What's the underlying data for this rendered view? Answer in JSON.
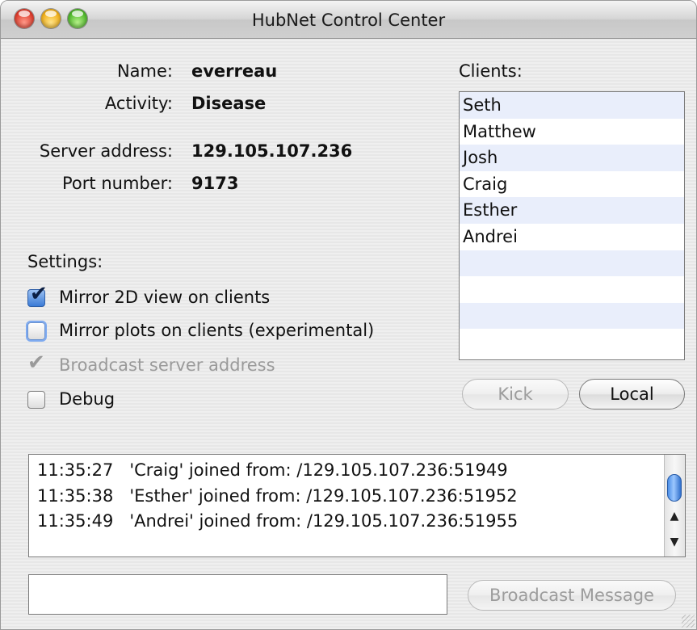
{
  "window": {
    "title": "HubNet Control Center"
  },
  "info": {
    "name_label": "Name:",
    "name_value": "everreau",
    "activity_label": "Activity:",
    "activity_value": "Disease",
    "server_label": "Server address:",
    "server_value": "129.105.107.236",
    "port_label": "Port number:",
    "port_value": "9173"
  },
  "clients": {
    "label": "Clients:",
    "items": [
      "Seth",
      "Matthew",
      "Josh",
      "Craig",
      "Esther",
      "Andrei"
    ]
  },
  "settings": {
    "label": "Settings:",
    "mirror_2d": {
      "label": "Mirror 2D view on clients",
      "checked": true,
      "enabled": true
    },
    "mirror_plots": {
      "label": "Mirror plots on clients (experimental)",
      "checked": false,
      "enabled": true
    },
    "broadcast_address": {
      "label": "Broadcast server address",
      "checked": true,
      "enabled": false
    },
    "debug": {
      "label": "Debug",
      "checked": false,
      "enabled": true
    }
  },
  "buttons": {
    "kick": "Kick",
    "local": "Local",
    "broadcast": "Broadcast Message"
  },
  "log": [
    "11:35:27   'Craig' joined from: /129.105.107.236:51949",
    "11:35:38   'Esther' joined from: /129.105.107.236:51952",
    "11:35:49   'Andrei' joined from: /129.105.107.236:51955"
  ],
  "message": {
    "value": ""
  }
}
